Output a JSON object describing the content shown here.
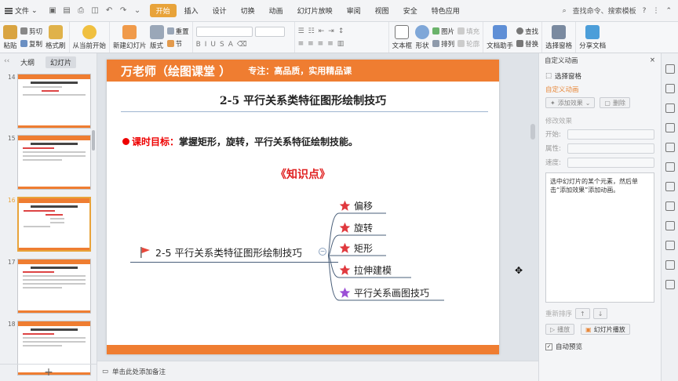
{
  "menubar": {
    "file_label": "文件",
    "tabs": [
      "开始",
      "插入",
      "设计",
      "切换",
      "动画",
      "幻灯片放映",
      "审阅",
      "视图",
      "安全",
      "特色应用"
    ],
    "active_tab": "开始",
    "search_label": "查找命令、搜索模板"
  },
  "ribbon": {
    "paste": "粘贴",
    "cut": "剪切",
    "copy": "复制",
    "format_painter": "格式刷",
    "play_from_current": "从当前开始",
    "new_slide": "新建幻灯片",
    "layout": "版式",
    "reset": "重置",
    "section": "节",
    "textbox": "文本框",
    "shape": "形状",
    "picture": "图片",
    "fill": "填充",
    "arrange": "排列",
    "outline": "轮廓",
    "doc_assistant": "文档助手",
    "find": "查找",
    "replace": "替换",
    "select_pane": "选择窗格",
    "share_doc": "分享文档"
  },
  "left_panel": {
    "tab_outline": "大纲",
    "tab_slides": "幻灯片",
    "slide_numbers": [
      "14",
      "15",
      "16",
      "17",
      "18"
    ],
    "selected_index": 2
  },
  "slide": {
    "brand": "万老师（绘图课堂 ）",
    "slogan": "专注：高品质，实用精品课",
    "title": "2-5 平行关系类特征图形绘制技巧",
    "goal_label": "课时目标：",
    "goal_text": "掌握矩形，旋转，平行关系特征绘制技能。",
    "knowledge_title": "《知识点》",
    "mindmap": {
      "root": "2-5 平行关系类特征图形绘制技巧",
      "collapse_symbol": "−",
      "nodes": [
        {
          "label": "偏移",
          "star_color": "#e0393e"
        },
        {
          "label": "旋转",
          "star_color": "#e0393e"
        },
        {
          "label": "矩形",
          "star_color": "#e0393e"
        },
        {
          "label": "拉伸建模",
          "star_color": "#e0393e"
        },
        {
          "label": "平行关系画图技巧",
          "star_color": "#9b4fd6"
        }
      ]
    },
    "accent_color": "#ef7d31"
  },
  "notes": {
    "placeholder": "单击此处添加备注"
  },
  "right_panel": {
    "title": "自定义动画",
    "select_pane": "选择窗格",
    "section_title": "自定义动画",
    "add_effect": "添加效果",
    "delete": "删除",
    "modify_effect": "修改效果",
    "start_label": "开始:",
    "property_label": "属性:",
    "speed_label": "速度:",
    "hint": "选中幻灯片的某个元素，然后单击“添加效果”添加动画。",
    "reorder": "重新排序",
    "play": "播放",
    "slideshow": "幻灯片播放",
    "auto_preview": "自动预览",
    "auto_preview_checked": true
  }
}
